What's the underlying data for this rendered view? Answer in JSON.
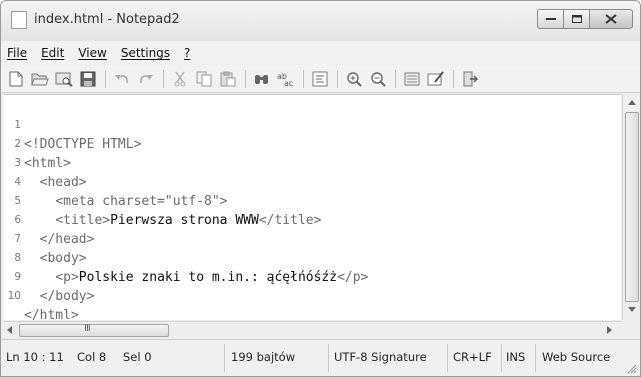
{
  "window": {
    "title": "index.html - Notepad2"
  },
  "menu": {
    "items": [
      "File",
      "Edit",
      "View",
      "Settings",
      "?"
    ]
  },
  "toolbar": {
    "icons": [
      "new-file-icon",
      "open-icon",
      "browse-icon",
      "save-icon",
      "undo-icon",
      "redo-icon",
      "cut-icon",
      "copy-icon",
      "paste-icon",
      "find-icon",
      "replace-icon",
      "word-wrap-icon",
      "zoom-in-icon",
      "zoom-out-icon",
      "scheme-icon",
      "customize-icon",
      "exit-icon"
    ]
  },
  "editor": {
    "lines": [
      {
        "num": "1",
        "indent": "",
        "markup": "<!DOCTYPE HTML>",
        "text": "",
        "closing": ""
      },
      {
        "num": "2",
        "indent": "",
        "markup": "<html>",
        "text": "",
        "closing": ""
      },
      {
        "num": "3",
        "indent": "  ",
        "markup": "<head>",
        "text": "",
        "closing": ""
      },
      {
        "num": "4",
        "indent": "    ",
        "markup": "<meta charset=\"utf-8\">",
        "text": "",
        "closing": ""
      },
      {
        "num": "5",
        "indent": "    ",
        "markup": "<title>",
        "text": "Pierwsza strona WWW",
        "closing": "</title>"
      },
      {
        "num": "6",
        "indent": "  ",
        "markup": "</head>",
        "text": "",
        "closing": ""
      },
      {
        "num": "7",
        "indent": "  ",
        "markup": "<body>",
        "text": "",
        "closing": ""
      },
      {
        "num": "8",
        "indent": "    ",
        "markup": "<p>",
        "text": "Polskie znaki to m.in.: ąćęłńóśźż",
        "closing": "</p>"
      },
      {
        "num": "9",
        "indent": "  ",
        "markup": "</body>",
        "text": "",
        "closing": ""
      },
      {
        "num": "10",
        "indent": "",
        "markup": "</html>",
        "text": "",
        "closing": ""
      }
    ]
  },
  "hscroll": {
    "thumb_grip": "III"
  },
  "status": {
    "position": "Ln 10 : 11",
    "column": "Col 8",
    "selection": "Sel 0",
    "size": "199 bajtów",
    "encoding": "UTF-8 Signature",
    "line_ending": "CR+LF",
    "insert_mode": "INS",
    "scheme": "Web Source"
  },
  "colors": {
    "markup": "#6a6a6a",
    "text": "#111111",
    "background": "#ffffff"
  }
}
